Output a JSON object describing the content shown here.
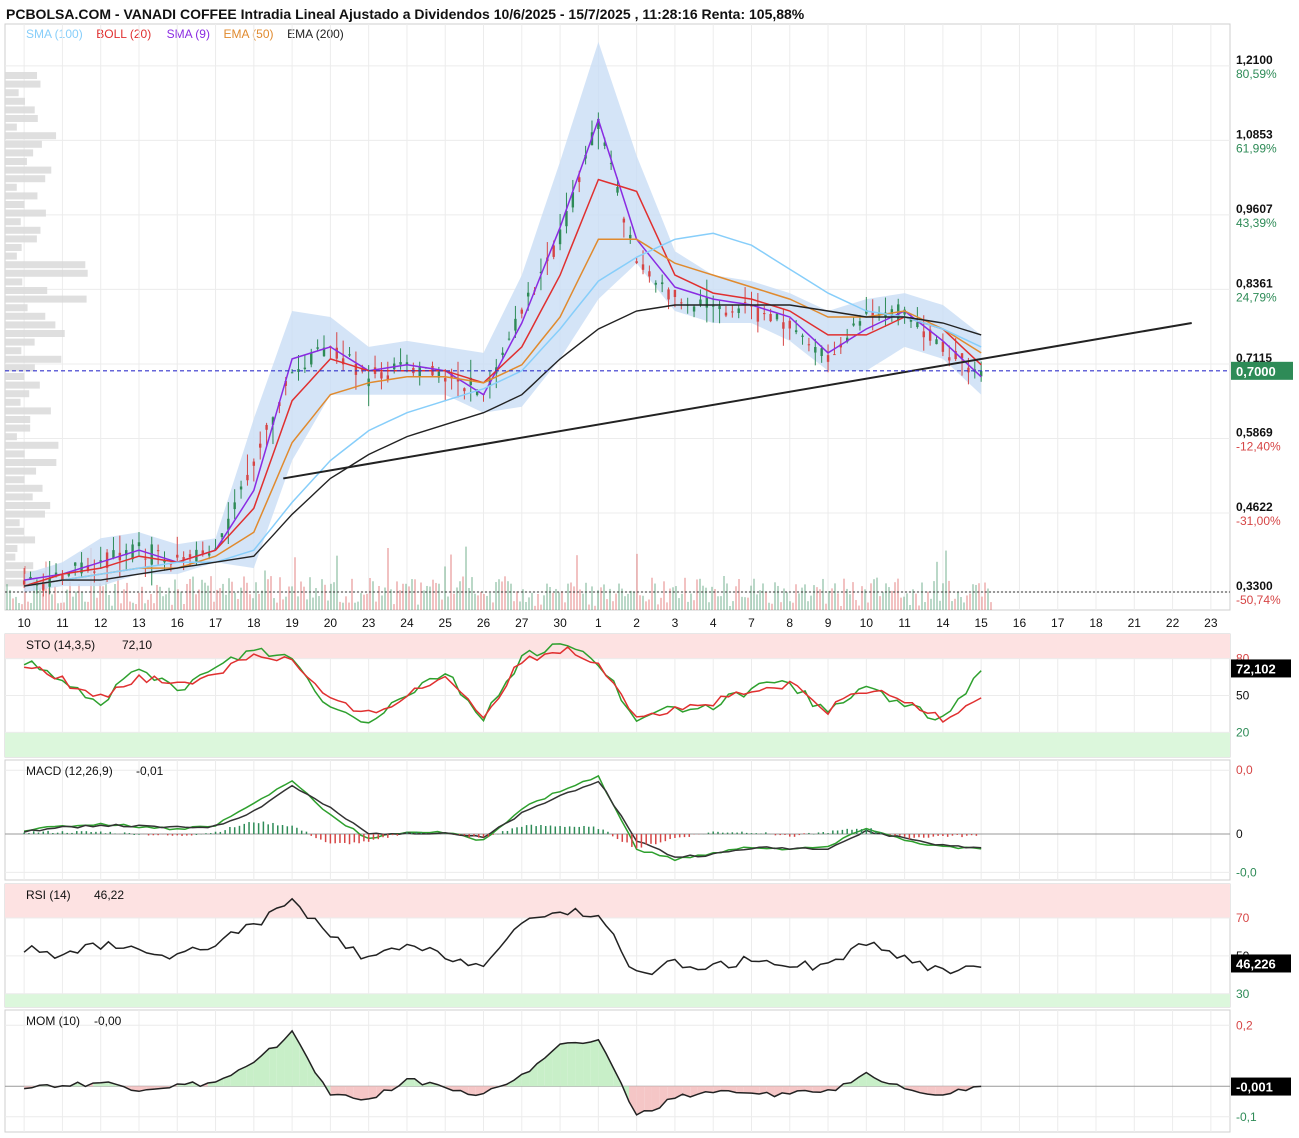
{
  "title": "PCBOLSA.COM - VANADI COFFEE Intradia Lineal Ajustado a Dividendos 10/6/2025 - 15/7/2025 , 11:28:16 Renta: 105,88%",
  "legend": [
    {
      "text": "SMA (100)",
      "color": "#87cefa"
    },
    {
      "text": "BOLL (20)",
      "color": "#e03030"
    },
    {
      "text": "SMA (9)",
      "color": "#8a2be2"
    },
    {
      "text": "EMA (50)",
      "color": "#e08a2e"
    },
    {
      "text": "EMA (200)",
      "color": "#222222"
    }
  ],
  "current_price_label": "0,7000",
  "colors": {
    "up": "#2e8b57",
    "down": "#d64545",
    "band": "#c9ddf5",
    "axis_green": "#2e8b57",
    "axis_red": "#d64545",
    "price_tag_bg": "#2e8b57"
  },
  "chart_data": [
    {
      "type": "line",
      "name": "price",
      "x": [
        "10",
        "11",
        "12",
        "13",
        "16",
        "17",
        "18",
        "19",
        "20",
        "23",
        "24",
        "25",
        "26",
        "27",
        "30",
        "1",
        "2",
        "3",
        "4",
        "7",
        "8",
        "9",
        "10",
        "11",
        "14",
        "15"
      ],
      "series": [
        {
          "name": "Precio",
          "values": [
            0.34,
            0.36,
            0.38,
            0.4,
            0.38,
            0.4,
            0.55,
            0.7,
            0.74,
            0.69,
            0.71,
            0.69,
            0.66,
            0.8,
            0.92,
            1.12,
            0.88,
            0.82,
            0.81,
            0.8,
            0.78,
            0.72,
            0.79,
            0.8,
            0.74,
            0.69
          ]
        },
        {
          "name": "SMA (9)",
          "values": [
            0.35,
            0.36,
            0.38,
            0.4,
            0.38,
            0.4,
            0.5,
            0.72,
            0.74,
            0.7,
            0.71,
            0.7,
            0.66,
            0.78,
            0.94,
            1.12,
            0.92,
            0.84,
            0.82,
            0.81,
            0.79,
            0.73,
            0.77,
            0.8,
            0.75,
            0.69
          ]
        },
        {
          "name": "BOLL (20)",
          "values": [
            0.34,
            0.36,
            0.37,
            0.39,
            0.38,
            0.4,
            0.47,
            0.65,
            0.72,
            0.7,
            0.7,
            0.7,
            0.68,
            0.74,
            0.86,
            1.02,
            1.0,
            0.86,
            0.83,
            0.82,
            0.8,
            0.76,
            0.76,
            0.79,
            0.77,
            0.71
          ]
        },
        {
          "name": "EMA (50)",
          "values": [
            0.34,
            0.35,
            0.36,
            0.37,
            0.37,
            0.39,
            0.43,
            0.58,
            0.66,
            0.68,
            0.69,
            0.69,
            0.68,
            0.71,
            0.79,
            0.92,
            0.92,
            0.88,
            0.86,
            0.84,
            0.82,
            0.79,
            0.79,
            0.8,
            0.77,
            0.73
          ]
        },
        {
          "name": "SMA (100)",
          "values": [
            0.34,
            0.35,
            0.36,
            0.37,
            0.38,
            0.38,
            0.4,
            0.48,
            0.55,
            0.6,
            0.63,
            0.65,
            0.67,
            0.7,
            0.77,
            0.85,
            0.89,
            0.92,
            0.93,
            0.91,
            0.87,
            0.83,
            0.8,
            0.79,
            0.77,
            0.74
          ]
        },
        {
          "name": "EMA (200)",
          "values": [
            0.34,
            0.35,
            0.35,
            0.36,
            0.37,
            0.38,
            0.39,
            0.46,
            0.52,
            0.56,
            0.59,
            0.61,
            0.63,
            0.66,
            0.72,
            0.77,
            0.8,
            0.81,
            0.81,
            0.81,
            0.81,
            0.8,
            0.79,
            0.79,
            0.78,
            0.76
          ]
        }
      ],
      "bb_upper": [
        0.36,
        0.38,
        0.42,
        0.43,
        0.41,
        0.42,
        0.62,
        0.8,
        0.79,
        0.74,
        0.75,
        0.74,
        0.73,
        0.86,
        1.05,
        1.25,
        1.06,
        0.9,
        0.86,
        0.85,
        0.83,
        0.8,
        0.82,
        0.83,
        0.81,
        0.76
      ],
      "bb_lower": [
        0.33,
        0.34,
        0.34,
        0.36,
        0.36,
        0.38,
        0.37,
        0.55,
        0.66,
        0.66,
        0.66,
        0.66,
        0.63,
        0.64,
        0.72,
        0.82,
        0.88,
        0.8,
        0.78,
        0.78,
        0.75,
        0.7,
        0.7,
        0.74,
        0.72,
        0.66
      ],
      "trendline": {
        "from": [
          0.5,
          0.52
        ],
        "to": [
          30.5,
          0.77
        ]
      },
      "hlines": [
        {
          "value": 0.7,
          "label": "0,7000"
        },
        {
          "value": 0.33,
          "label": "0,3300"
        }
      ],
      "y_ticks": [
        {
          "price": 1.21,
          "price_label": "1,2100",
          "pct_label": "80,59%",
          "pct_sign": "pos"
        },
        {
          "price": 1.0853,
          "price_label": "1,0853",
          "pct_label": "61,99%",
          "pct_sign": "pos"
        },
        {
          "price": 0.9607,
          "price_label": "0,9607",
          "pct_label": "43,39%",
          "pct_sign": "pos"
        },
        {
          "price": 0.8361,
          "price_label": "0,8361",
          "pct_label": "24,79%",
          "pct_sign": "pos"
        },
        {
          "price": 0.7115,
          "price_label": "0,7115",
          "pct_label": "",
          "pct_sign": "pos"
        },
        {
          "price": 0.5869,
          "price_label": "0,5869",
          "pct_label": "-12,40%",
          "pct_sign": "neg"
        },
        {
          "price": 0.4622,
          "price_label": "0,4622",
          "pct_label": "-31,00%",
          "pct_sign": "neg"
        },
        {
          "price": 0.33,
          "price_label": "0,3300",
          "pct_label": "-50,74%",
          "pct_sign": "neg"
        }
      ],
      "x_ticks": [
        "10",
        "11",
        "12",
        "13",
        "16",
        "17",
        "18",
        "19",
        "20",
        "23",
        "24",
        "25",
        "26",
        "27",
        "30",
        "1",
        "2",
        "3",
        "4",
        "7",
        "8",
        "9",
        "10",
        "11",
        "14",
        "15",
        "16",
        "17",
        "18",
        "21",
        "22",
        "23"
      ],
      "ylim": [
        0.3,
        1.28
      ]
    },
    {
      "type": "line",
      "name": "STO (14,3,5)",
      "label": "STO (14,3,5)",
      "value_text": "72,10",
      "last_tag": "72,102",
      "levels": [
        {
          "value": 80,
          "label": "80"
        },
        {
          "value": 50,
          "label": "50"
        },
        {
          "value": 20,
          "label": "20"
        }
      ],
      "series": [
        {
          "name": "%K",
          "values": [
            78,
            60,
            45,
            70,
            55,
            72,
            88,
            80,
            40,
            30,
            52,
            70,
            30,
            82,
            92,
            78,
            28,
            40,
            42,
            55,
            60,
            35,
            58,
            42,
            30,
            72
          ]
        },
        {
          "name": "%D",
          "values": [
            75,
            62,
            48,
            66,
            58,
            68,
            84,
            78,
            45,
            34,
            50,
            66,
            34,
            78,
            88,
            78,
            34,
            38,
            44,
            52,
            58,
            38,
            54,
            45,
            32,
            50
          ]
        }
      ],
      "ylim": [
        0,
        100
      ]
    },
    {
      "type": "line",
      "name": "MACD (12,26,9)",
      "label": "MACD (12,26,9)",
      "value_text": "-0,01",
      "levels": [
        {
          "value": 0.05,
          "label": "0,0"
        },
        {
          "value": 0,
          "label": "0"
        },
        {
          "value": -0.03,
          "label": "-0,0"
        }
      ],
      "series": [
        {
          "name": "MACD",
          "values": [
            0.003,
            0.006,
            0.008,
            0.006,
            0.004,
            0.007,
            0.024,
            0.042,
            0.015,
            -0.004,
            0.002,
            0.001,
            -0.005,
            0.02,
            0.034,
            0.045,
            -0.012,
            -0.02,
            -0.015,
            -0.01,
            -0.012,
            -0.01,
            0.005,
            -0.005,
            -0.01,
            -0.012
          ]
        },
        {
          "name": "Signal",
          "values": [
            0.002,
            0.005,
            0.007,
            0.006,
            0.005,
            0.006,
            0.018,
            0.038,
            0.02,
            0.0,
            0.001,
            0.001,
            -0.003,
            0.016,
            0.03,
            0.042,
            -0.005,
            -0.018,
            -0.016,
            -0.011,
            -0.011,
            -0.011,
            0.002,
            -0.003,
            -0.009,
            -0.011
          ]
        }
      ],
      "ylim": [
        -0.036,
        0.058
      ]
    },
    {
      "type": "line",
      "name": "RSI (14)",
      "label": "RSI (14)",
      "value_text": "46,22",
      "last_tag": "46,226",
      "levels": [
        {
          "value": 70,
          "label": "70"
        },
        {
          "value": 50,
          "label": "50"
        },
        {
          "value": 30,
          "label": "30"
        }
      ],
      "series": [
        {
          "name": "RSI",
          "values": [
            54,
            50,
            56,
            52,
            50,
            57,
            66,
            79,
            60,
            48,
            55,
            50,
            45,
            66,
            74,
            72,
            40,
            46,
            44,
            48,
            46,
            44,
            58,
            48,
            42,
            46
          ]
        }
      ],
      "ylim": [
        23,
        88
      ]
    },
    {
      "type": "area",
      "name": "MOM (10)",
      "label": "MOM (10)",
      "value_text": "-0,00",
      "last_tag": "-0,001",
      "levels": [
        {
          "value": 0.2,
          "label": "0,2"
        },
        {
          "value": 0,
          "label": ""
        },
        {
          "value": -0.1,
          "label": "-0,1"
        }
      ],
      "series": [
        {
          "name": "MOM",
          "values": [
            0.0,
            0.0,
            0.01,
            -0.01,
            0.0,
            0.01,
            0.07,
            0.18,
            -0.03,
            -0.04,
            0.02,
            0.0,
            -0.03,
            0.04,
            0.13,
            0.16,
            -0.1,
            -0.04,
            -0.02,
            -0.03,
            -0.02,
            -0.02,
            0.04,
            0.0,
            -0.03,
            -0.001
          ]
        }
      ],
      "ylim": [
        -0.15,
        0.25
      ]
    }
  ]
}
